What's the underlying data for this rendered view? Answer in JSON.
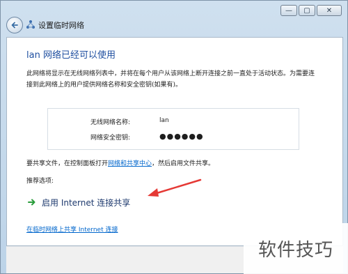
{
  "window": {
    "title": "设置临时网络",
    "caption": {
      "minimize": "—",
      "maximize": "▢",
      "close": "✕"
    }
  },
  "main": {
    "heading": "lan 网络已经可以使用",
    "description": "此网络将显示在无线网络列表中，并将在每个用户从该网络上断开连接之前一直处于活动状态。为需要连接到此网络上的用户提供网络名称和安全密钥(如果有)。",
    "network_name_label": "无线网络名称:",
    "network_name_value": "lan",
    "security_key_label": "网络安全密钥:",
    "security_key_value": "●●●●●●",
    "share_prefix": "要共享文件，在控制面板打开",
    "share_link": "网络和共享中心",
    "share_suffix": "，然后启用文件共享。",
    "recommend_label": "推荐选项:",
    "enable_ics_label": "启用 Internet 连接共享",
    "bottom_link": "在临时网络上共享 Internet 连接"
  },
  "watermark": "软件技巧",
  "colors": {
    "heading": "#1f4fa0",
    "link": "#0066cc",
    "arrow_green": "#2a9d3b",
    "annotation_red": "#e53935"
  }
}
